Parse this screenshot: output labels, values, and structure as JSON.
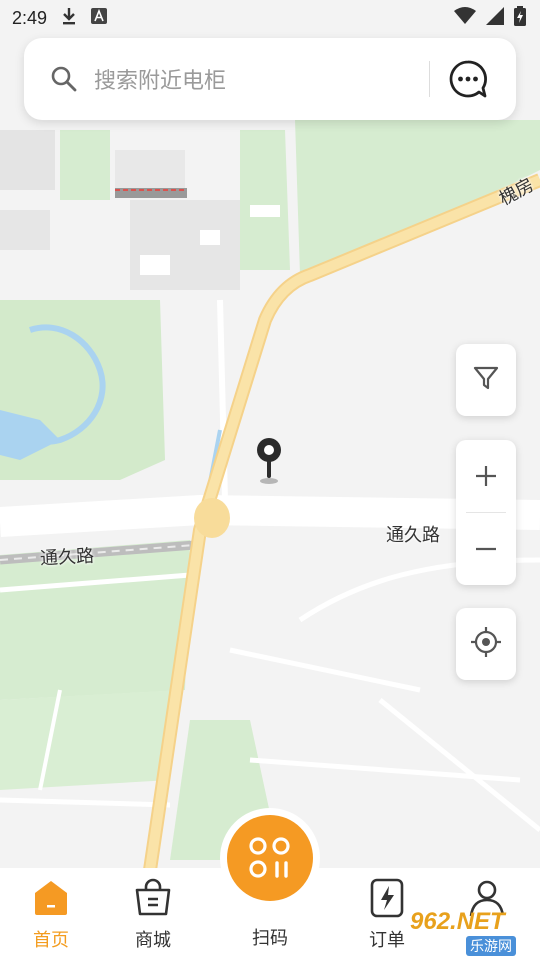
{
  "status_bar": {
    "time": "2:49"
  },
  "search": {
    "placeholder": "搜索附近电柜"
  },
  "map_labels": {
    "road_east": "通久路",
    "road_west": "通久路",
    "road_ne": "槐房"
  },
  "bottom_nav": {
    "home": "首页",
    "mall": "商城",
    "scan": "扫码",
    "orders": "订单",
    "profile": ""
  },
  "watermark": {
    "brand": "962.NET",
    "sub": "乐游网"
  },
  "colors": {
    "accent": "#f59a23",
    "active_text": "#f39c1f",
    "road_main": "#f8dc9a",
    "green": "#cfe8c7",
    "water": "#aad3f0"
  }
}
